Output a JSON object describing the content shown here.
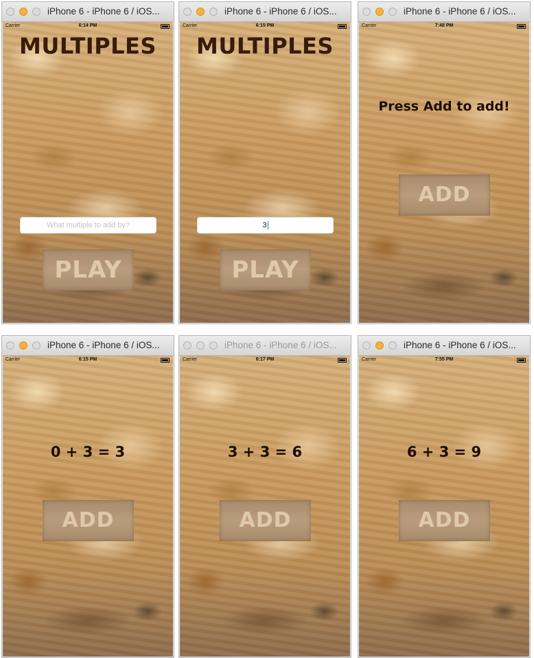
{
  "screens": [
    {
      "window_title": "iPhone 6 - iPhone 6 / iOS...",
      "status": {
        "carrier": "Carrier",
        "time": "6:14 PM"
      },
      "heading": "MULTIPLES",
      "input": {
        "placeholder": "What multiple to add by?",
        "value": ""
      },
      "button": "PLAY"
    },
    {
      "window_title": "iPhone 6 - iPhone 6 / iOS...",
      "status": {
        "carrier": "Carrier",
        "time": "6:15 PM"
      },
      "heading": "MULTIPLES",
      "input": {
        "placeholder": "What multiple to add by?",
        "value": "3"
      },
      "button": "PLAY"
    },
    {
      "window_title": "iPhone 6 - iPhone 6 / iOS...",
      "status": {
        "carrier": "Carrier",
        "time": "7:48 PM"
      },
      "heading": "Press Add to add!",
      "button": "ADD"
    },
    {
      "window_title": "iPhone 6 - iPhone 6 / iOS...",
      "status": {
        "carrier": "Carrier",
        "time": "6:15 PM"
      },
      "heading": "0 + 3 = 3",
      "button": "ADD"
    },
    {
      "window_title": "iPhone 6 - iPhone 6 / iOS...",
      "status": {
        "carrier": "Carrier",
        "time": "6:17 PM"
      },
      "heading": "3 + 3 = 6",
      "button": "ADD"
    },
    {
      "window_title": "iPhone 6 - iPhone 6 / iOS...",
      "status": {
        "carrier": "Carrier",
        "time": "7:55 PM"
      },
      "heading": "6 + 3 = 9",
      "button": "ADD"
    }
  ]
}
